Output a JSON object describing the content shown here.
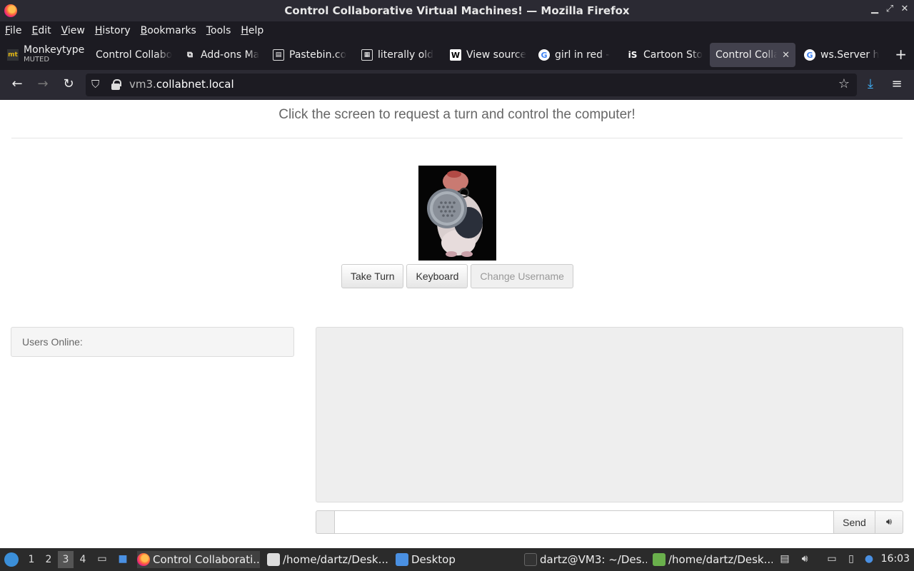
{
  "window": {
    "title": "Control Collaborative Virtual Machines! — Mozilla Firefox",
    "controls": [
      "minimize-icon",
      "restore-icon",
      "close-icon"
    ]
  },
  "menu": [
    "File",
    "Edit",
    "View",
    "History",
    "Bookmarks",
    "Tools",
    "Help"
  ],
  "tabs": [
    {
      "label": "Monkeytype",
      "sub": "MUTED",
      "icon": "mt"
    },
    {
      "label": "Control Collabo",
      "icon": ""
    },
    {
      "label": "Add-ons Ma",
      "icon": "addons-icon"
    },
    {
      "label": "Pastebin.co",
      "icon": "pastebin-icon"
    },
    {
      "label": "literally old",
      "icon": "doc-icon"
    },
    {
      "label": "View source",
      "icon": "W"
    },
    {
      "label": "girl in red -",
      "icon": "G"
    },
    {
      "label": "Cartoon Sto",
      "icon": "iS"
    },
    {
      "label": "Control Colla",
      "icon": "",
      "active": true
    },
    {
      "label": "ws.Server h",
      "icon": "G"
    }
  ],
  "nav": {
    "url_prefix": "vm3.",
    "url_domain": "collabnet.local"
  },
  "page": {
    "instruction": "Click the screen to request a turn and control the computer!",
    "buttons": {
      "take_turn": "Take Turn",
      "keyboard": "Keyboard",
      "change_username": "Change Username"
    },
    "users_online": "Users Online:",
    "chat": {
      "input_value": "",
      "send": "Send"
    }
  },
  "taskbar": {
    "workspaces": [
      "1",
      "2",
      "3",
      "4"
    ],
    "current_workspace": "3",
    "tasks": [
      {
        "label": "Control Collaborati...",
        "active": true
      },
      {
        "label": "/home/dartz/Desk..."
      },
      {
        "label": "Desktop"
      },
      {
        "label": "dartz@VM3: ~/Des..."
      },
      {
        "label": "/home/dartz/Desk..."
      }
    ],
    "clock": "16:03"
  }
}
